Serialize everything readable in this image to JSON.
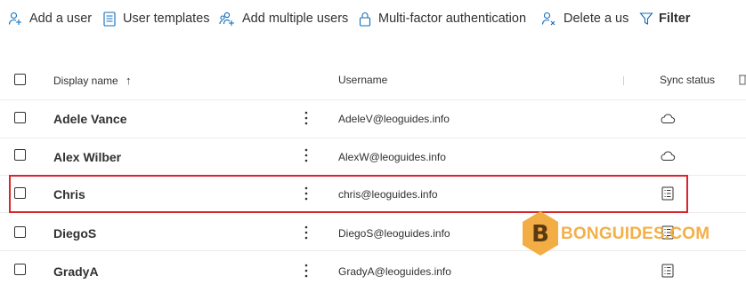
{
  "toolbar": {
    "add_user": {
      "label": "Add a user",
      "icon": "person-add-icon"
    },
    "user_templates": {
      "label": "User templates",
      "icon": "document-list-icon"
    },
    "add_multiple": {
      "label": "Add multiple users",
      "icon": "people-add-icon"
    },
    "mfa": {
      "label": "Multi-factor authentication",
      "icon": "lock-icon"
    },
    "delete_user": {
      "label": "Delete a us",
      "icon": "person-delete-icon"
    },
    "filter": {
      "label": "Filter",
      "icon": "filter-icon"
    }
  },
  "table": {
    "columns": {
      "display_name": "Display name",
      "sort_indicator": "↑",
      "username": "Username",
      "sync_status": "Sync status"
    },
    "rows": [
      {
        "display_name": "Adele Vance",
        "username": "AdeleV@leoguides.info",
        "sync_icon": "cloud-icon"
      },
      {
        "display_name": "Alex Wilber",
        "username": "AlexW@leoguides.info",
        "sync_icon": "cloud-icon"
      },
      {
        "display_name": "Chris",
        "username": "chris@leoguides.info",
        "sync_icon": "directory-synced-icon"
      },
      {
        "display_name": "DiegoS",
        "username": "DiegoS@leoguides.info",
        "sync_icon": "directory-synced-icon"
      },
      {
        "display_name": "GradyA",
        "username": "GradyA@leoguides.info",
        "sync_icon": "directory-synced-icon"
      }
    ],
    "highlighted_row": "Chris"
  },
  "watermark": {
    "text": "BONGUIDES.COM",
    "logo_letter": "B"
  },
  "colors": {
    "accent": "#0078d4",
    "highlight": "#d9262c",
    "watermark": "#f2a93b",
    "text": "#323130"
  }
}
